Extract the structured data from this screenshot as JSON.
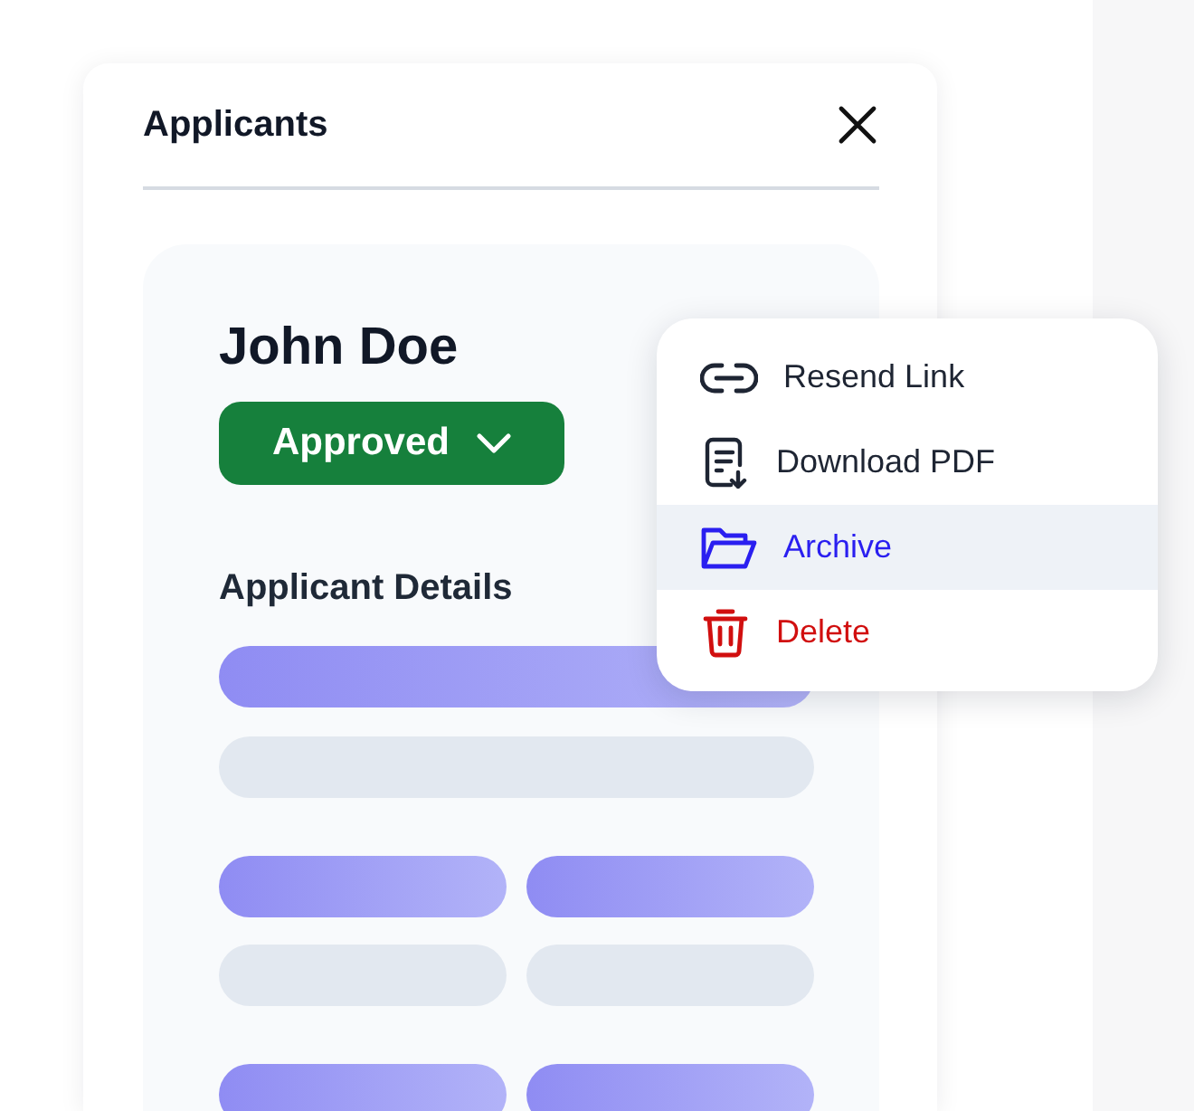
{
  "panel": {
    "title": "Applicants"
  },
  "applicant": {
    "name": "John Doe",
    "status": "Approved",
    "section_title": "Applicant Details"
  },
  "menu": [
    {
      "label": "Resend Link",
      "kind": "default",
      "selected": false
    },
    {
      "label": "Download PDF",
      "kind": "default",
      "selected": false
    },
    {
      "label": "Archive",
      "kind": "default",
      "selected": true
    },
    {
      "label": "Delete",
      "kind": "danger",
      "selected": false
    }
  ]
}
